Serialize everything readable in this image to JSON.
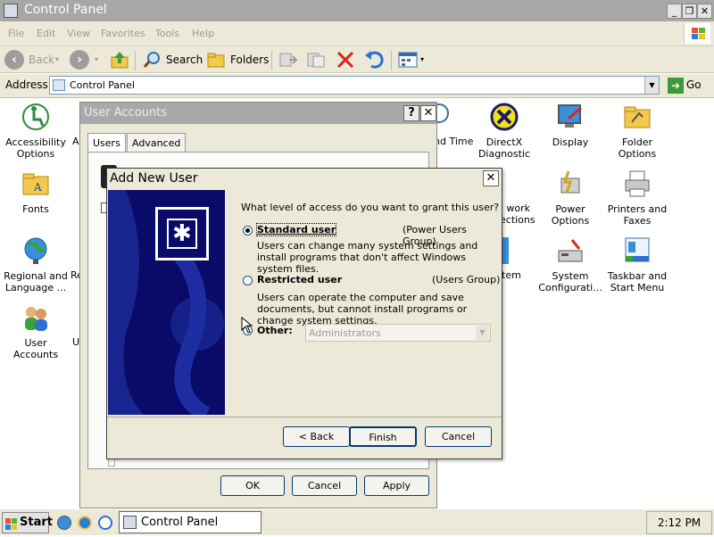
{
  "window": {
    "title": "Control Panel",
    "controls": {
      "minimize": "_",
      "restore": "❐",
      "close": "✕"
    }
  },
  "menubar": {
    "items": [
      "File",
      "Edit",
      "View",
      "Favorites",
      "Tools",
      "Help"
    ]
  },
  "toolbar": {
    "back": "Back",
    "search": "Search",
    "folders": "Folders"
  },
  "address": {
    "label": "Address",
    "value": "Control Panel",
    "go": "Go"
  },
  "control_panel_items": [
    {
      "label": "Accessibility Options",
      "icon": "accessibility-icon"
    },
    {
      "label": "Fonts",
      "icon": "fonts-folder-icon"
    },
    {
      "label": "Regional and Language ...",
      "icon": "globe-icon"
    },
    {
      "label": "User Accounts",
      "icon": "users-icon"
    },
    {
      "label": "nd Time",
      "icon": "clock-icon"
    },
    {
      "label": "DirectX Diagnostic",
      "icon": "directx-icon"
    },
    {
      "label": "Display",
      "icon": "display-icon"
    },
    {
      "label": "Folder Options",
      "icon": "folder-options-icon"
    },
    {
      "label": "work ections",
      "icon": "network-icon"
    },
    {
      "label": "Power Options",
      "icon": "power-icon"
    },
    {
      "label": "Printers and Faxes",
      "icon": "printer-icon"
    },
    {
      "label": "tem",
      "icon": "system-icon"
    },
    {
      "label": "System Configurati...",
      "icon": "sysconfig-icon"
    },
    {
      "label": "Taskbar and Start Menu",
      "icon": "taskbar-icon"
    }
  ],
  "partial_labels": {
    "a": "A",
    "re": "Re",
    "u": "U"
  },
  "user_accounts_dialog": {
    "title": "User Accounts",
    "tabs": [
      "Users",
      "Advanced"
    ],
    "buttons": {
      "ok": "OK",
      "cancel": "Cancel",
      "apply": "Apply"
    }
  },
  "add_new_user_dialog": {
    "title": "Add New User",
    "question": "What level of access do you want to grant this user?",
    "options": [
      {
        "name": "Standard user",
        "group": "(Power Users Group)",
        "description": "Users can change many system settings and install programs that don't affect Windows system files.",
        "selected": true
      },
      {
        "name": "Restricted user",
        "group": "(Users Group)",
        "description": "Users can operate the computer and save documents, but cannot install programs or change system settings.",
        "selected": false
      }
    ],
    "other_label": "Other:",
    "other_value": "Administrators",
    "buttons": {
      "back": "< Back",
      "finish": "Finish",
      "cancel": "Cancel"
    }
  },
  "taskbar": {
    "start": "Start",
    "task": "Control Panel",
    "clock": "2:12 PM"
  }
}
